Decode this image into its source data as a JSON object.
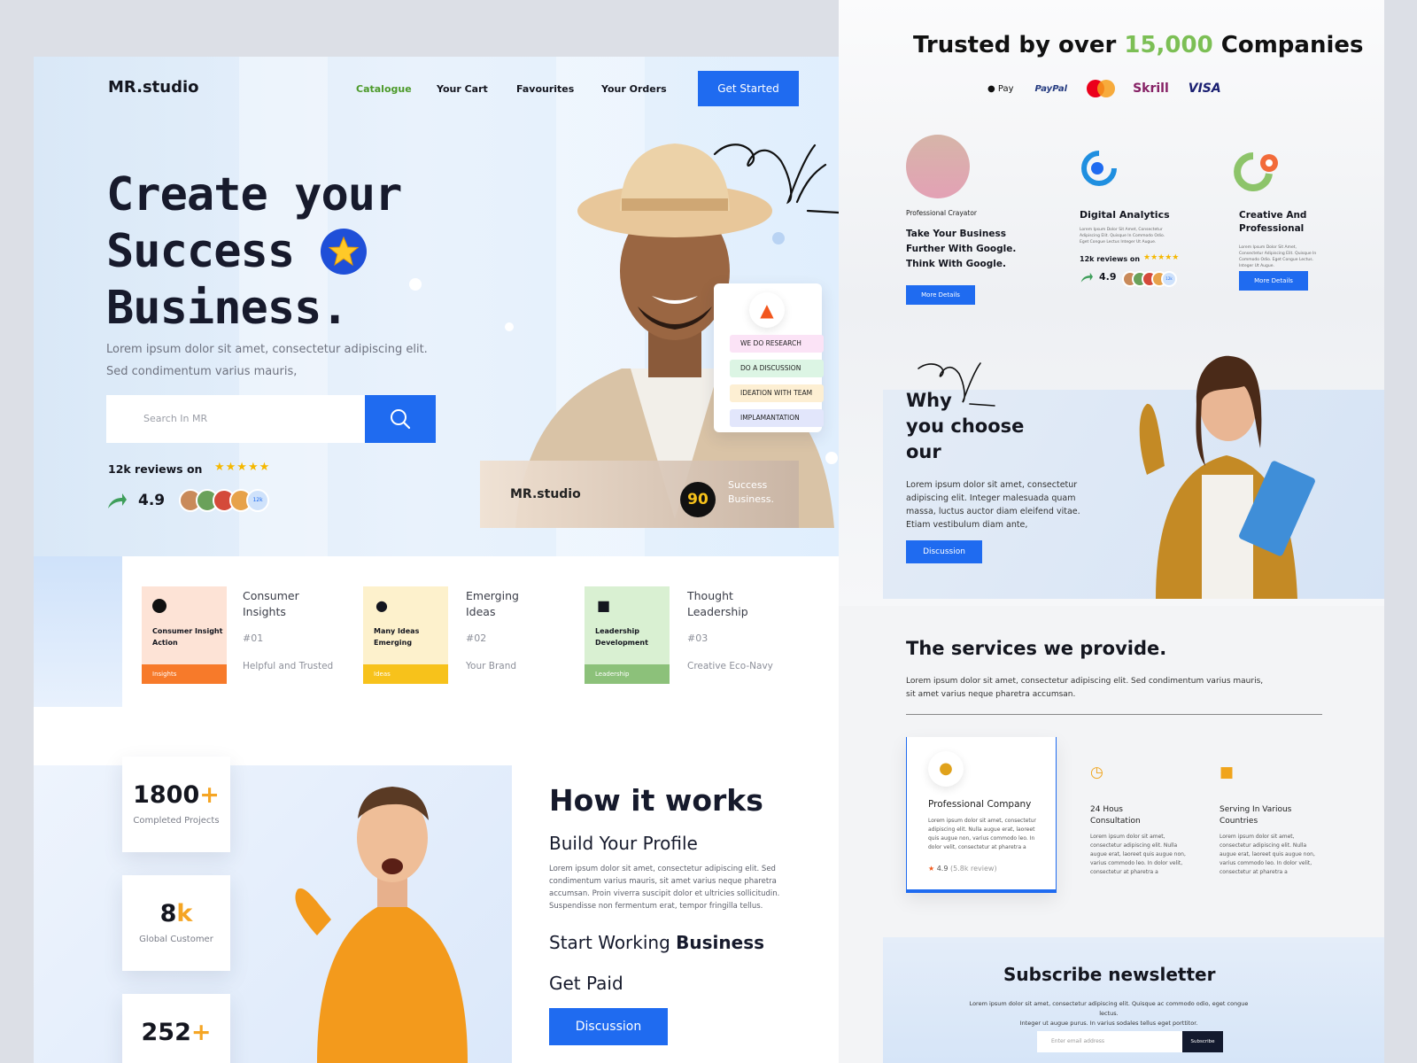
{
  "nav": {
    "brand": "MR.studio",
    "links": [
      "Catalogue",
      "Your Cart",
      "Favourites",
      "Your Orders"
    ],
    "cta": "Get Started"
  },
  "hero": {
    "headline_1": "Create your",
    "headline_2": "Success",
    "headline_3": "Business.",
    "sub_1": "Lorem ipsum dolor sit amet, consectetur adipiscing elit.",
    "sub_2": "Sed condimentum varius mauris,",
    "search_placeholder": "Search In MR",
    "reviews_label": "12k reviews on",
    "rating": "4.9",
    "avatar_badge": "12k",
    "card_brand": "MR.studio",
    "card_badge": "90",
    "card_caption_1": "Success",
    "card_caption_2": "Business.",
    "steps": [
      "WE DO RESEARCH",
      "DO A DISCUSSION",
      "IDEATION WITH TEAM",
      "IMPLAMANTATION"
    ]
  },
  "features": [
    {
      "card_title": "Consumer Insight Action",
      "tag": "Insights",
      "title_1": "Consumer",
      "title_2": "Insights",
      "num": "#01",
      "sub": "Helpful and Trusted",
      "bg": "#fde3d6",
      "accent": "#f77a2a"
    },
    {
      "card_title": "Many Ideas Emerging",
      "tag": "Ideas",
      "title_1": "Emerging",
      "title_2": "Ideas",
      "num": "#02",
      "sub": "Your Brand",
      "bg": "#fdf1cc",
      "accent": "#f7c21b"
    },
    {
      "card_title": "Leadership Development",
      "tag": "Leadership",
      "title_1": "Thought",
      "title_2": "Leadership",
      "num": "#03",
      "sub": "Creative Eco-Navy",
      "bg": "#d9f0d2",
      "accent": "#8cc17a"
    }
  ],
  "stats": [
    {
      "num": "1800",
      "plus": "+",
      "label": "Completed Projects"
    },
    {
      "num": "8",
      "plus": "k",
      "label": "Global Customer"
    },
    {
      "num": "252",
      "plus": "+",
      "label": ""
    }
  ],
  "how": {
    "title": "How it works",
    "step1": "Build Your Profile",
    "text": "Lorem ipsum dolor sit amet, consectetur adipiscing elit. Sed condimentum varius mauris, sit amet varius neque pharetra accumsan. Proin viverra suscipit dolor et ultricies sollicitudin. Suspendisse non fermentum erat, tempor fringilla tellus.",
    "step2_a": "Start Working",
    "step2_b": "Business",
    "step3": "Get Paid",
    "button": "Discussion"
  },
  "trusted": {
    "prefix": "Trusted by over",
    "count": "15,000",
    "suffix": "Companies",
    "logos": [
      "Pay",
      "PayPal",
      "MasterCard",
      "Skrill",
      "VISA"
    ]
  },
  "partners": [
    {
      "kicker": "Professional Crayator",
      "title": "Take Your Business Further With Google. Think With Google.",
      "button": "More Details"
    },
    {
      "title": "Digital Analytics",
      "text": "Lorem Ipsum Dolor Sit Amet, Consectetur Adipiscing Elit. Quisque In Commodo Odio. Eget Congue Lectus Integer Ut Augue.",
      "reviews": "12k reviews on",
      "rating": "4.9",
      "badge": "12k"
    },
    {
      "title": "Creative And Professional",
      "text": "Lorem Ipsum Dolor Sit Amet, Consectetur Adipiscing Elit. Quisque In Commodo Odio. Eget Congue Lectus. Integer Ut Augue.",
      "button": "More Details"
    }
  ],
  "why": {
    "line1": "Why",
    "line2": "you choose",
    "line3": "our",
    "text": "Lorem ipsum dolor sit amet, consectetur adipiscing elit. Integer malesuada quam massa, luctus auctor diam eleifend vitae. Etiam vestibulum diam ante,",
    "button": "Discussion"
  },
  "services": {
    "title": "The services we provide.",
    "text_1": "Lorem ipsum dolor sit amet, consectetur adipiscing elit. Sed condimentum varius mauris,",
    "text_2": "sit amet varius neque pharetra accumsan.",
    "items": [
      {
        "title": "Professional Company",
        "text": "Lorem ipsum dolor sit amet, consectetur adipiscing elit. Nulla augue erat, laoreet quis augue non, varius commodo leo. In dolor velit, consectetur at pharetra a",
        "rating": "4.9",
        "reviews": "(5.8k review)"
      },
      {
        "title_1": "24 Hous",
        "title_2": "Consultation",
        "text": "Lorem ipsum dolor sit amet, consectetur adipiscing elit. Nulla augue erat, laoreet quis augue non, varius commodo leo. In dolor velit, consectetur at pharetra a"
      },
      {
        "title_1": "Serving In Various",
        "title_2": "Countries",
        "text": "Lorem ipsum dolor sit amet, consectetur adipiscing elit. Nulla augue erat, laoreet quis augue non, varius commodo leo. In dolor velit, consectetur at pharetra a"
      }
    ]
  },
  "newsletter": {
    "title": "Subscribe newsletter",
    "text_1": "Lorem ipsum dolor sit amet, consectetur adipiscing elit. Quisque ac commodo odio, eget congue lectus.",
    "text_2": "Integer ut augue purus. In varius sodales tellus eget porttitor.",
    "placeholder": "Enter email address",
    "button": "Subscribe"
  },
  "colors": {
    "accent": "#1f6bf0",
    "green": "#7cbf55",
    "orange": "#f5a524"
  }
}
